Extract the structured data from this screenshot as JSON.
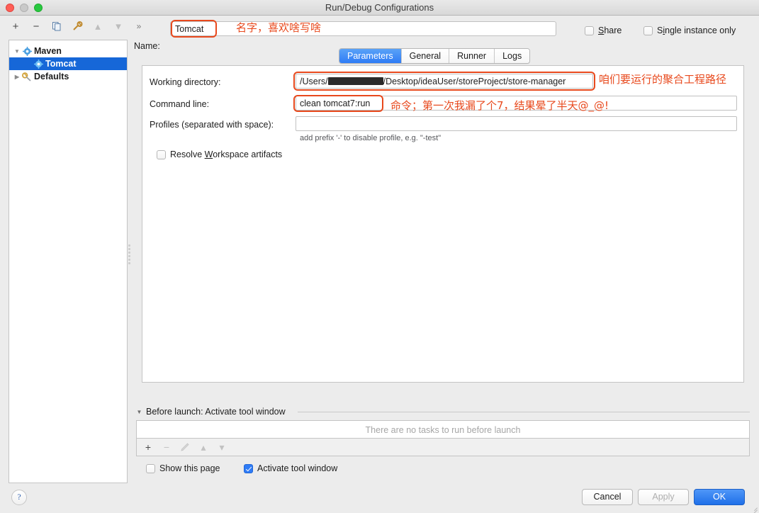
{
  "window": {
    "title": "Run/Debug Configurations",
    "traffic_lights": [
      "close",
      "minimize",
      "zoom"
    ]
  },
  "toolbar": {
    "icons": [
      {
        "name": "add-icon",
        "glyph": "+",
        "enabled": true
      },
      {
        "name": "remove-icon",
        "glyph": "−",
        "enabled": true
      },
      {
        "name": "copy-icon",
        "glyph": "❐",
        "enabled": true
      },
      {
        "name": "edit-defaults-icon",
        "glyph": "⚒",
        "enabled": true
      },
      {
        "name": "move-up-icon",
        "glyph": "▴",
        "enabled": false
      },
      {
        "name": "move-down-icon",
        "glyph": "▾",
        "enabled": false
      },
      {
        "name": "more-icon",
        "glyph": "»",
        "enabled": true
      }
    ],
    "name_label": "Name:",
    "name_value": "Tomcat",
    "share": {
      "label": "Share",
      "mnemonic": "S",
      "checked": false
    },
    "single_instance": {
      "label_before": "S",
      "label": "Single instance only",
      "mnemonic": "i",
      "checked": false
    }
  },
  "sidebar": {
    "items": [
      {
        "label": "Maven",
        "icon": "gear-icon",
        "expanded": true,
        "selected": false,
        "level": 0
      },
      {
        "label": "Tomcat",
        "icon": "gear-icon",
        "selected": true,
        "level": 1
      },
      {
        "label": "Defaults",
        "icon": "wrench-icon",
        "expanded": false,
        "selected": false,
        "level": 0
      }
    ]
  },
  "main": {
    "tabs": [
      {
        "label": "Parameters",
        "active": true
      },
      {
        "label": "General",
        "active": false
      },
      {
        "label": "Runner",
        "active": false
      },
      {
        "label": "Logs",
        "active": false
      }
    ],
    "fields": {
      "working_directory": {
        "label": "Working directory:",
        "value_prefix": "/Users/",
        "value_redacted": "████████",
        "value_suffix": "/Desktop/ideaUser/storeProject/store-manager",
        "full_value": "/Users/[redacted]/Desktop/ideaUser/storeProject/store-manager"
      },
      "command_line": {
        "label": "Command line:",
        "value": "clean tomcat7:run"
      },
      "profiles": {
        "label": "Profiles (separated with space):",
        "value": "",
        "hint": "add prefix '-' to disable profile, e.g. \"-test\""
      },
      "resolve_workspace_artifacts": {
        "label": "Resolve Workspace artifacts",
        "mnemonic": "W",
        "checked": false
      }
    }
  },
  "before_launch": {
    "header": "Before launch: Activate tool window",
    "empty_text": "There are no tasks to run before launch",
    "toolbar_icons": [
      {
        "name": "add-task-icon",
        "glyph": "+",
        "enabled": true
      },
      {
        "name": "remove-task-icon",
        "glyph": "−",
        "enabled": false
      },
      {
        "name": "edit-task-icon",
        "glyph": "✎",
        "enabled": false
      },
      {
        "name": "move-task-up-icon",
        "glyph": "▴",
        "enabled": false
      },
      {
        "name": "move-task-down-icon",
        "glyph": "▾",
        "enabled": false
      }
    ],
    "show_this_page": {
      "label": "Show this page",
      "checked": false
    },
    "activate_tool_window": {
      "label": "Activate tool window",
      "checked": true
    }
  },
  "footer": {
    "help_glyph": "?",
    "cancel_label": "Cancel",
    "apply_label": "Apply",
    "apply_enabled": false,
    "ok_label": "OK"
  },
  "annotations": [
    {
      "id": "name-note",
      "text": "名字，喜欢啥写啥"
    },
    {
      "id": "workdir-note",
      "text": "咱们要运行的聚合工程路径"
    },
    {
      "id": "cmdline-note",
      "text": "命令；第一次我漏了个7，结果晕了半天@_@!"
    }
  ],
  "colors": {
    "accent": "#2f7cf6",
    "selection": "#1667d8",
    "annotation": "#e8491d"
  }
}
